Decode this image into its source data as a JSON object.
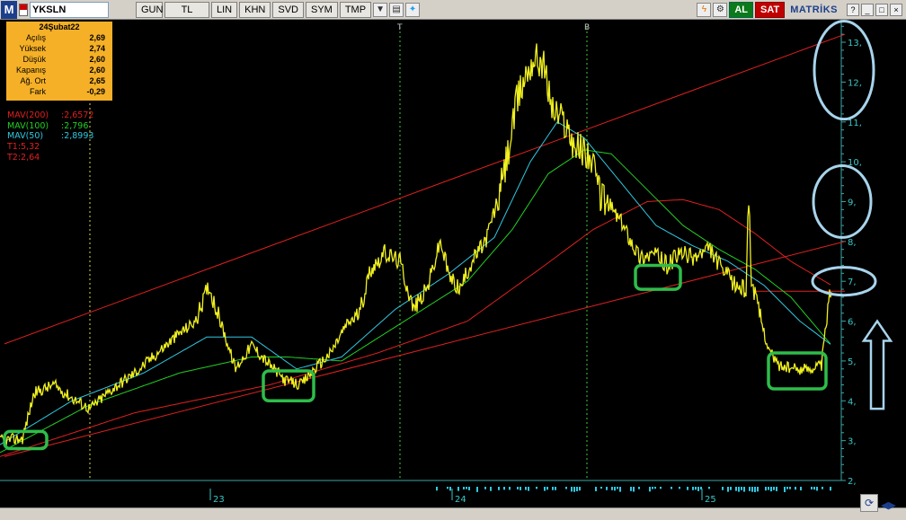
{
  "toolbar": {
    "logo": "M",
    "symbol": "YKSLN",
    "period": "GUN",
    "currency": "TL",
    "buttons": [
      "LIN",
      "KHN",
      "SVD",
      "SYM",
      "TMP"
    ],
    "buy_label": "AL",
    "sell_label": "SAT",
    "brand": "MATRİKS"
  },
  "info": {
    "date": "24Şubat22",
    "rows": [
      {
        "k": "Açılış",
        "v": "2,69"
      },
      {
        "k": "Yüksek",
        "v": "2,74"
      },
      {
        "k": "Düşük",
        "v": "2,60"
      },
      {
        "k": "Kapanış",
        "v": "2,60"
      },
      {
        "k": "Ağ. Ort",
        "v": "2,65"
      },
      {
        "k": "Fark",
        "v": "-0,29"
      }
    ]
  },
  "indicators": [
    {
      "name": "MAV(200)",
      "value": ":2,6572",
      "color": "#e02020"
    },
    {
      "name": "MAV(100)",
      "value": ":2,796",
      "color": "#22d022"
    },
    {
      "name": "MAV(50)",
      "value": ":2,8993",
      "color": "#30c8e0"
    },
    {
      "name": "T1:5,32",
      "value": "",
      "color": "#e02020"
    },
    {
      "name": "T2:2,64",
      "value": "",
      "color": "#e02020"
    }
  ],
  "chart_data": {
    "type": "line",
    "x_tick_labels": [
      "23",
      "24",
      "25"
    ],
    "y_tick_labels": [
      "2,",
      "3,",
      "4,",
      "5,",
      "6,",
      "7,",
      "8,",
      "9,",
      "10,",
      "11,",
      "12,",
      "13,"
    ],
    "y_ticks": [
      2,
      3,
      4,
      5,
      6,
      7,
      8,
      9,
      10,
      11,
      12,
      13
    ],
    "ylim": [
      2,
      13.3
    ],
    "markers": [
      {
        "label": "T",
        "x": 445
      },
      {
        "label": "B",
        "x": 653
      }
    ],
    "price_anchors": [
      [
        0,
        3.0
      ],
      [
        25,
        3.05
      ],
      [
        38,
        4.2
      ],
      [
        60,
        4.4
      ],
      [
        78,
        4.1
      ],
      [
        100,
        3.8
      ],
      [
        125,
        4.3
      ],
      [
        150,
        4.7
      ],
      [
        175,
        5.2
      ],
      [
        200,
        5.7
      ],
      [
        218,
        6.0
      ],
      [
        232,
        6.9
      ],
      [
        248,
        5.8
      ],
      [
        262,
        4.8
      ],
      [
        280,
        5.4
      ],
      [
        300,
        4.9
      ],
      [
        318,
        4.5
      ],
      [
        335,
        4.4
      ],
      [
        350,
        4.8
      ],
      [
        368,
        5.2
      ],
      [
        385,
        5.9
      ],
      [
        400,
        6.2
      ],
      [
        412,
        7.3
      ],
      [
        428,
        7.7
      ],
      [
        445,
        7.5
      ],
      [
        460,
        6.3
      ],
      [
        475,
        6.8
      ],
      [
        490,
        8.0
      ],
      [
        500,
        7.1
      ],
      [
        512,
        6.8
      ],
      [
        525,
        7.5
      ],
      [
        540,
        8.0
      ],
      [
        556,
        9.2
      ],
      [
        566,
        10.3
      ],
      [
        575,
        11.5
      ],
      [
        585,
        12.2
      ],
      [
        594,
        12.6
      ],
      [
        604,
        12.5
      ],
      [
        615,
        11.3
      ],
      [
        628,
        11.0
      ],
      [
        640,
        10.4
      ],
      [
        655,
        10.2
      ],
      [
        668,
        9.2
      ],
      [
        682,
        8.8
      ],
      [
        696,
        8.3
      ],
      [
        712,
        7.6
      ],
      [
        728,
        7.7
      ],
      [
        742,
        7.4
      ],
      [
        757,
        7.7
      ],
      [
        772,
        7.6
      ],
      [
        790,
        7.8
      ],
      [
        803,
        7.3
      ],
      [
        818,
        6.9
      ],
      [
        830,
        6.8
      ],
      [
        833,
        9.3
      ],
      [
        836,
        7.0
      ],
      [
        845,
        6.2
      ],
      [
        855,
        5.3
      ],
      [
        866,
        4.9
      ],
      [
        880,
        4.8
      ],
      [
        896,
        4.8
      ],
      [
        914,
        4.9
      ],
      [
        921,
        6.3
      ],
      [
        925,
        6.9
      ]
    ],
    "mav200_anchors": [
      [
        0,
        2.6
      ],
      [
        150,
        3.7
      ],
      [
        300,
        4.4
      ],
      [
        420,
        5.2
      ],
      [
        520,
        6.0
      ],
      [
        600,
        7.3
      ],
      [
        660,
        8.3
      ],
      [
        720,
        9.0
      ],
      [
        760,
        9.05
      ],
      [
        800,
        8.8
      ],
      [
        840,
        8.2
      ],
      [
        880,
        7.5
      ],
      [
        925,
        6.9
      ]
    ],
    "mav100_anchors": [
      [
        0,
        2.7
      ],
      [
        100,
        3.9
      ],
      [
        200,
        4.7
      ],
      [
        280,
        5.1
      ],
      [
        320,
        5.1
      ],
      [
        380,
        5.0
      ],
      [
        450,
        6.0
      ],
      [
        520,
        7.0
      ],
      [
        570,
        8.3
      ],
      [
        610,
        9.7
      ],
      [
        650,
        10.3
      ],
      [
        680,
        10.2
      ],
      [
        720,
        9.3
      ],
      [
        760,
        8.4
      ],
      [
        800,
        7.8
      ],
      [
        840,
        7.3
      ],
      [
        880,
        6.6
      ],
      [
        925,
        5.4
      ]
    ],
    "mav50_anchors": [
      [
        0,
        2.9
      ],
      [
        80,
        4.0
      ],
      [
        160,
        4.7
      ],
      [
        230,
        5.6
      ],
      [
        280,
        5.6
      ],
      [
        330,
        4.8
      ],
      [
        380,
        5.1
      ],
      [
        440,
        6.3
      ],
      [
        500,
        7.2
      ],
      [
        550,
        8.1
      ],
      [
        590,
        10.0
      ],
      [
        620,
        11.0
      ],
      [
        650,
        10.6
      ],
      [
        690,
        9.5
      ],
      [
        730,
        8.4
      ],
      [
        770,
        7.9
      ],
      [
        810,
        7.5
      ],
      [
        850,
        6.9
      ],
      [
        890,
        6.0
      ],
      [
        925,
        5.4
      ]
    ],
    "trend_lines": [
      {
        "name": "upper",
        "x1": 5,
        "y1": 5.43,
        "x2": 940,
        "y2": 13.2
      },
      {
        "name": "middle",
        "x1": 5,
        "y1": 2.6,
        "x2": 940,
        "y2": 8.0
      },
      {
        "name": "T1 level",
        "x1": 838,
        "y1": 6.75,
        "x2": 940,
        "y2": 6.75
      }
    ],
    "green_boxes": [
      {
        "x1": 5,
        "x2": 52,
        "y1": 2.8,
        "y2": 3.23
      },
      {
        "x1": 293,
        "x2": 349,
        "y1": 4.0,
        "y2": 4.75
      },
      {
        "x1": 707,
        "x2": 757,
        "y1": 6.8,
        "y2": 7.4
      },
      {
        "x1": 855,
        "x2": 919,
        "y1": 4.3,
        "y2": 5.2
      }
    ],
    "blue_ellipses": [
      {
        "cx": 939,
        "cy": 12.3,
        "rx": 33,
        "ry": 1.23
      },
      {
        "cx": 937,
        "cy": 9.0,
        "rx": 32,
        "ry": 0.9
      },
      {
        "cx": 939,
        "cy": 7.0,
        "rx": 35,
        "ry": 0.35
      }
    ],
    "up_arrow": {
      "x": 976,
      "y_top": 6.0,
      "y_bottom": 3.8
    }
  }
}
